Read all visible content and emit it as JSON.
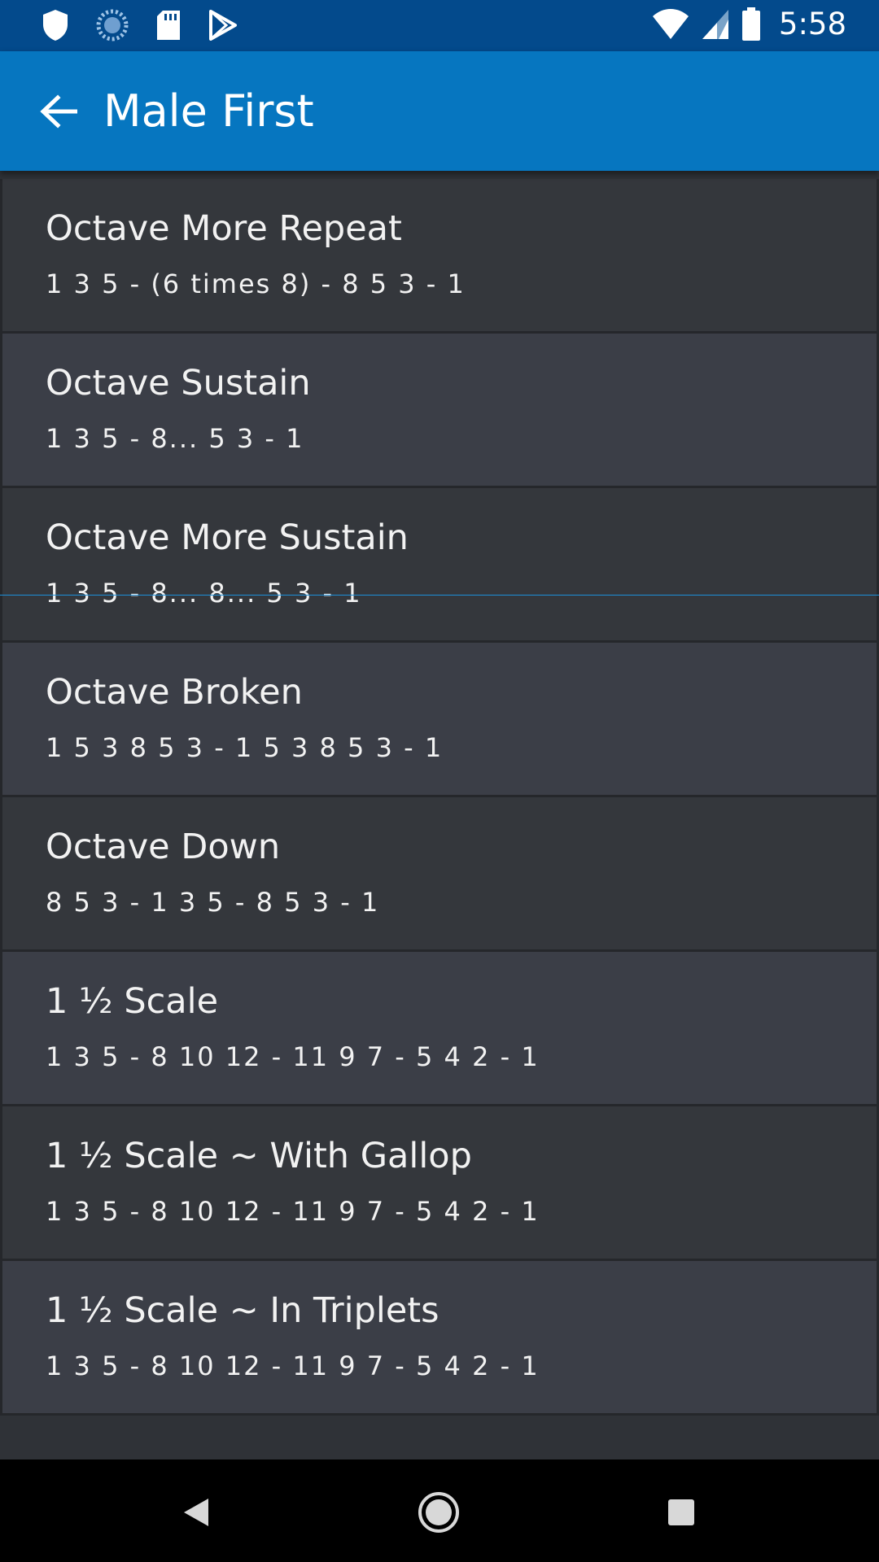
{
  "status_bar": {
    "left_icons": [
      "shield-icon",
      "loading-icon",
      "sd-card-icon",
      "play-store-icon"
    ],
    "right_icons": [
      "wifi-icon",
      "signal-icon",
      "battery-icon"
    ],
    "time": "5:58",
    "background": "#034a8c"
  },
  "app_bar": {
    "title": "Male First",
    "back_icon": "back-arrow-icon",
    "background": "#0676c0"
  },
  "list": {
    "items": [
      {
        "title": "Octave More Repeat",
        "subtitle": "1 3 5 - (6 times 8) - 8 5 3 - 1"
      },
      {
        "title": "Octave Sustain",
        "subtitle": "1 3 5 - 8... 5 3 - 1"
      },
      {
        "title": "Octave More Sustain",
        "subtitle": "1 3 5 - 8... 8... 5 3 - 1"
      },
      {
        "title": "Octave Broken",
        "subtitle": "1 5 3 8 5 3 - 1 5 3 8 5 3 - 1"
      },
      {
        "title": "Octave Down",
        "subtitle": "8 5 3 - 1 3 5 - 8 5 3 - 1"
      },
      {
        "title": "1 ½ Scale",
        "subtitle": "1 3 5 - 8 10 12 - 11 9 7 - 5 4 2 - 1"
      },
      {
        "title": "1 ½ Scale ~ With Gallop",
        "subtitle": "1 3 5 - 8 10 12 - 11 9 7 - 5 4 2 - 1"
      },
      {
        "title": "1 ½ Scale ~ In Triplets",
        "subtitle": "1 3 5 - 8 10 12 - 11 9 7 - 5 4 2 - 1"
      }
    ]
  },
  "nav_bar": {
    "buttons": [
      "back-triangle-icon",
      "home-circle-icon",
      "recents-square-icon"
    ]
  }
}
